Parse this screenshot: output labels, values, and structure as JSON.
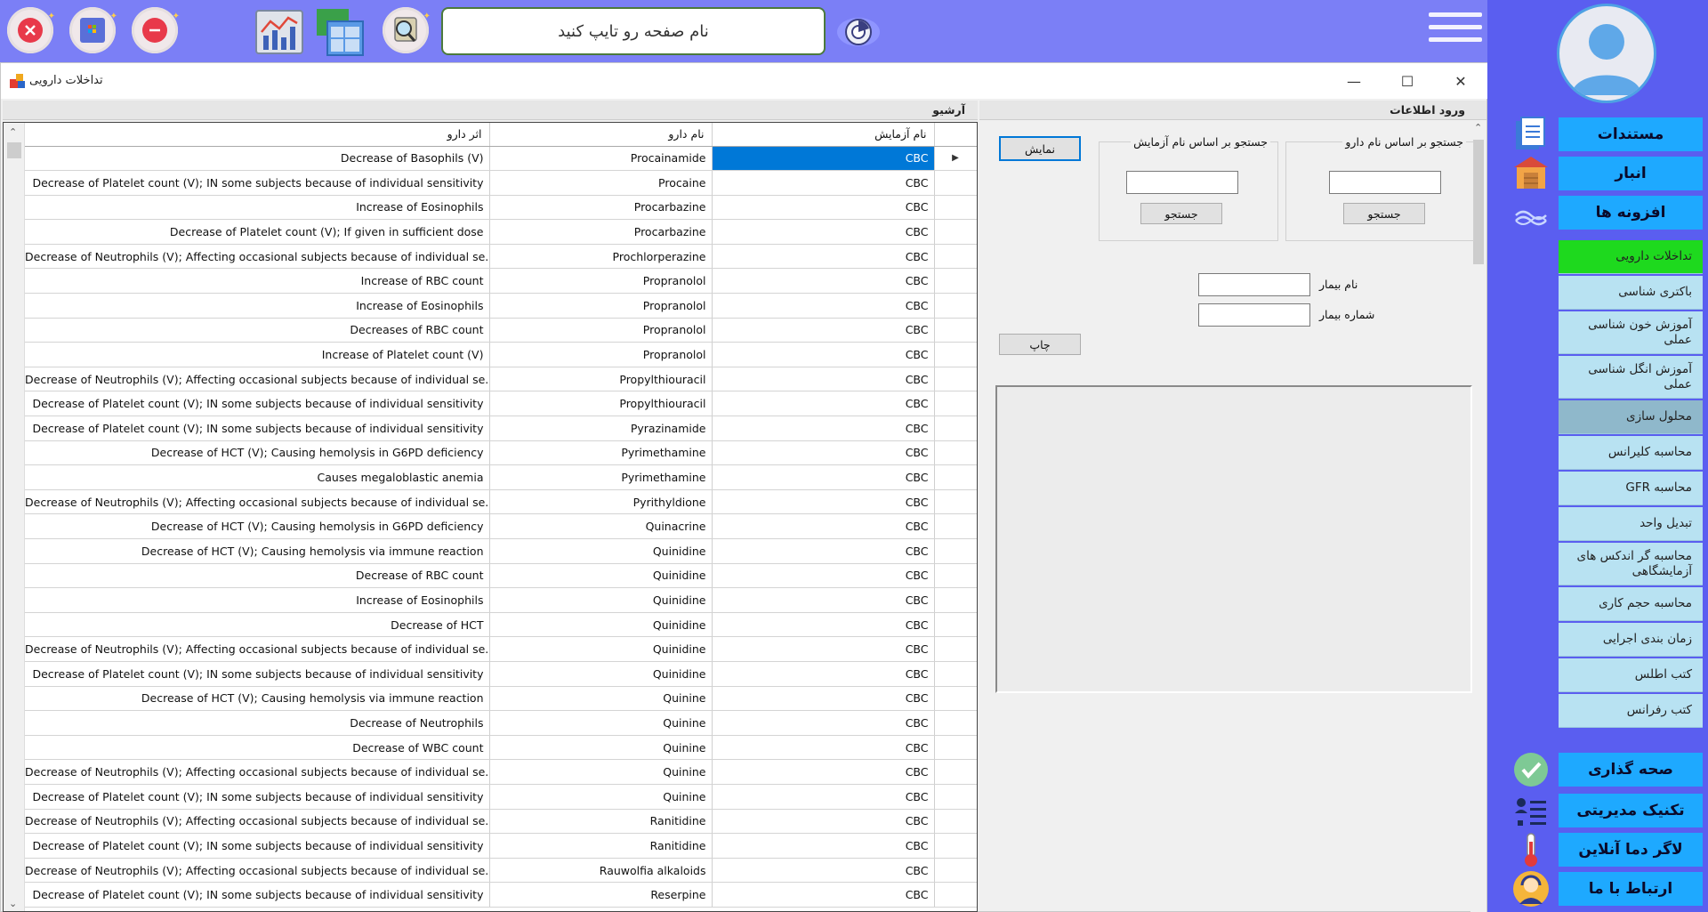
{
  "topbar": {
    "search_placeholder": "نام صفحه رو تایپ کنید"
  },
  "window": {
    "title": "تداخلات دارویی",
    "minimize": "—",
    "maximize": "☐",
    "close": "✕"
  },
  "archive": {
    "header": "آرشیو",
    "columns": [
      "نام آزمایش",
      "نام دارو",
      "اثر دارو"
    ],
    "rows": [
      {
        "test": "CBC",
        "drug": "Procainamide",
        "effect": "Decrease of Basophils (V)"
      },
      {
        "test": "CBC",
        "drug": "Procaine",
        "effect": "Decrease of Platelet count (V); IN some subjects because of individual sensitivity"
      },
      {
        "test": "CBC",
        "drug": "Procarbazine",
        "effect": "Increase of Eosinophils"
      },
      {
        "test": "CBC",
        "drug": "Procarbazine",
        "effect": "Decrease of Platelet count (V); If given in sufficient dose"
      },
      {
        "test": "CBC",
        "drug": "Prochlorperazine",
        "effect": "Decrease of Neutrophils (V); Affecting occasional subjects because of individual se..."
      },
      {
        "test": "CBC",
        "drug": "Propranolol",
        "effect": "Increase of RBC count"
      },
      {
        "test": "CBC",
        "drug": "Propranolol",
        "effect": "Increase of Eosinophils"
      },
      {
        "test": "CBC",
        "drug": "Propranolol",
        "effect": "Decreases of RBC count"
      },
      {
        "test": "CBC",
        "drug": "Propranolol",
        "effect": "Increase of Platelet count (V)"
      },
      {
        "test": "CBC",
        "drug": "Propylthiouracil",
        "effect": "Decrease of Neutrophils (V); Affecting occasional subjects because of individual se..."
      },
      {
        "test": "CBC",
        "drug": "Propylthiouracil",
        "effect": "Decrease of Platelet count (V); IN some subjects because of individual sensitivity"
      },
      {
        "test": "CBC",
        "drug": "Pyrazinamide",
        "effect": "Decrease of Platelet count (V); IN some subjects because of individual sensitivity"
      },
      {
        "test": "CBC",
        "drug": "Pyrimethamine",
        "effect": "Decrease of HCT (V); Causing hemolysis in G6PD deficiency"
      },
      {
        "test": "CBC",
        "drug": "Pyrimethamine",
        "effect": "Causes megaloblastic anemia"
      },
      {
        "test": "CBC",
        "drug": "Pyrithyldione",
        "effect": "Decrease of Neutrophils (V); Affecting occasional subjects because of individual se..."
      },
      {
        "test": "CBC",
        "drug": "Quinacrine",
        "effect": "Decrease of HCT (V); Causing hemolysis in G6PD deficiency"
      },
      {
        "test": "CBC",
        "drug": "Quinidine",
        "effect": "Decrease of HCT (V); Causing hemolysis via immune reaction"
      },
      {
        "test": "CBC",
        "drug": "Quinidine",
        "effect": "Decrease of RBC count"
      },
      {
        "test": "CBC",
        "drug": "Quinidine",
        "effect": "Increase of Eosinophils"
      },
      {
        "test": "CBC",
        "drug": "Quinidine",
        "effect": "Decrease of HCT"
      },
      {
        "test": "CBC",
        "drug": "Quinidine",
        "effect": "Decrease of Neutrophils (V); Affecting occasional subjects because of individual se..."
      },
      {
        "test": "CBC",
        "drug": "Quinidine",
        "effect": "Decrease of Platelet count (V); IN some subjects because of individual sensitivity"
      },
      {
        "test": "CBC",
        "drug": "Quinine",
        "effect": "Decrease of HCT (V); Causing hemolysis via immune reaction"
      },
      {
        "test": "CBC",
        "drug": "Quinine",
        "effect": "Decrease of Neutrophils"
      },
      {
        "test": "CBC",
        "drug": "Quinine",
        "effect": "Decrease of WBC count"
      },
      {
        "test": "CBC",
        "drug": "Quinine",
        "effect": "Decrease of Neutrophils (V); Affecting occasional subjects because of individual se..."
      },
      {
        "test": "CBC",
        "drug": "Quinine",
        "effect": "Decrease of Platelet count (V); IN some subjects because of individual sensitivity"
      },
      {
        "test": "CBC",
        "drug": "Ranitidine",
        "effect": "Decrease of Neutrophils (V); Affecting occasional subjects because of individual se..."
      },
      {
        "test": "CBC",
        "drug": "Ranitidine",
        "effect": "Decrease of Platelet count (V); IN some subjects because of individual sensitivity"
      },
      {
        "test": "CBC",
        "drug": "Rauwolfia alkaloids",
        "effect": "Decrease of Neutrophils (V); Affecting occasional subjects because of individual se..."
      },
      {
        "test": "CBC",
        "drug": "Reserpine",
        "effect": "Decrease of Platelet count (V); IN some subjects because of individual sensitivity"
      }
    ]
  },
  "entry": {
    "header": "ورود اطلاعات",
    "show_button": "نمایش",
    "group_test": "جستجو بر اساس نام آزمایش",
    "group_drug": "جستجو بر اساس نام دارو",
    "search_button": "جستجو",
    "patient_name_label": "نام بیمار",
    "patient_number_label": "شماره بیمار",
    "print_button": "چاپ"
  },
  "sidebar": {
    "main1": [
      "مستندات",
      "انبار",
      "افزونه ها"
    ],
    "sub": [
      "تداخلات دارویی",
      "باکتری شناسی",
      "آموزش خون شناسی عملی",
      "آموزش انگل شناسی عملی",
      "محلول سازی",
      "محاسبه کلیرانس",
      "محاسبه GFR",
      "تبدیل واحد",
      "محاسبه گر اندکس های آزمایشگاهی",
      "محاسبه حجم کاری",
      "زمان بندی اجرایی",
      "کتب اطلس",
      "کتب رفرانس"
    ],
    "main2": [
      "صحه گذاری",
      "تکنیک مدیریتی",
      "لاگر دما آنلاین",
      "ارتباط با ما"
    ]
  },
  "colors": {
    "topbar": "#7b7ff6",
    "sidebar": "#5a5ef0",
    "sidebar_button": "#1ea9ff",
    "active_item": "#1ed91e",
    "selection": "#0078d7"
  }
}
